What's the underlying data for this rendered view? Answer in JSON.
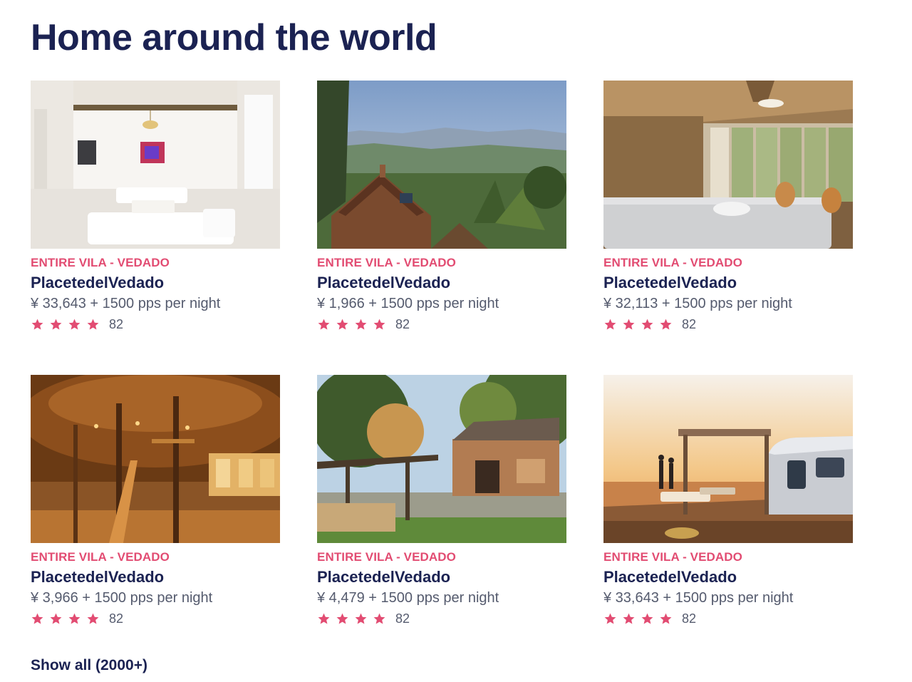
{
  "section": {
    "title": "Home around the world",
    "show_all": "Show all (2000+)"
  },
  "colors": {
    "heading": "#1b2252",
    "accent": "#e24c72",
    "muted": "#555b6e"
  },
  "listings": [
    {
      "kind": "ENTIRE VILA - VEDADO",
      "title": "PlacetedelVedado",
      "price": "¥ 33,643 + 1500 pps per night",
      "stars": 4,
      "reviews": "82",
      "photo": "white-villa-living-room"
    },
    {
      "kind": "ENTIRE VILA - VEDADO",
      "title": "PlacetedelVedado",
      "price": "¥ 1,966 + 1500 pps per night",
      "stars": 4,
      "reviews": "82",
      "photo": "mountain-valley-cottage"
    },
    {
      "kind": "ENTIRE VILA - VEDADO",
      "title": "PlacetedelVedado",
      "price": "¥ 32,113 + 1500 pps per night",
      "stars": 4,
      "reviews": "82",
      "photo": "bamboo-bedroom"
    },
    {
      "kind": "ENTIRE VILA - VEDADO",
      "title": "PlacetedelVedado",
      "price": "¥ 3,966 + 1500 pps per night",
      "stars": 4,
      "reviews": "82",
      "photo": "bamboo-house-interior"
    },
    {
      "kind": "ENTIRE VILA - VEDADO",
      "title": "PlacetedelVedado",
      "price": "¥ 4,479 + 1500 pps per night",
      "stars": 4,
      "reviews": "82",
      "photo": "forest-cob-cottage"
    },
    {
      "kind": "ENTIRE VILA - VEDADO",
      "title": "PlacetedelVedado",
      "price": "¥ 33,643 + 1500 pps per night",
      "stars": 4,
      "reviews": "82",
      "photo": "airstream-sunset-deck"
    }
  ]
}
